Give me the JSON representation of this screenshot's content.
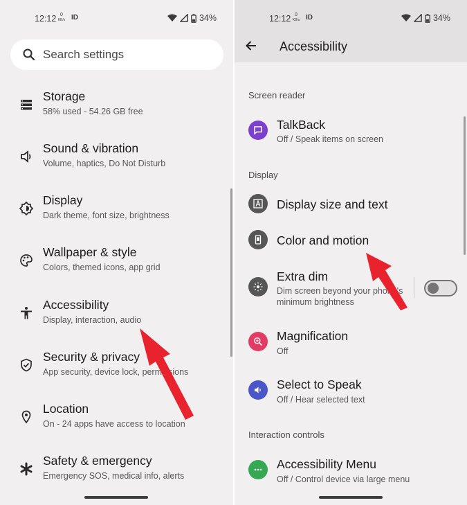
{
  "left": {
    "status": {
      "time": "12:12",
      "net_value": "0",
      "net_unit": "KB/s",
      "battery": "34%"
    },
    "search": {
      "placeholder": "Search settings"
    },
    "items": [
      {
        "title": "Storage",
        "subtitle": "58% used - 54.26 GB free",
        "icon": "storage-icon"
      },
      {
        "title": "Sound & vibration",
        "subtitle": "Volume, haptics, Do Not Disturb",
        "icon": "speaker-icon"
      },
      {
        "title": "Display",
        "subtitle": "Dark theme, font size, brightness",
        "icon": "brightness-icon"
      },
      {
        "title": "Wallpaper & style",
        "subtitle": "Colors, themed icons, app grid",
        "icon": "palette-icon"
      },
      {
        "title": "Accessibility",
        "subtitle": "Display, interaction, audio",
        "icon": "accessibility-icon"
      },
      {
        "title": "Security & privacy",
        "subtitle": "App security, device lock, permissions",
        "icon": "shield-icon"
      },
      {
        "title": "Location",
        "subtitle": "On - 24 apps have access to location",
        "icon": "location-pin-icon"
      },
      {
        "title": "Safety & emergency",
        "subtitle": "Emergency SOS, medical info, alerts",
        "icon": "asterisk-icon"
      }
    ]
  },
  "right": {
    "status": {
      "time": "12:12",
      "net_value": "0",
      "net_unit": "KB/s",
      "battery": "34%"
    },
    "appbar": {
      "title": "Accessibility"
    },
    "sections": {
      "screen_reader": "Screen reader",
      "display": "Display",
      "interaction": "Interaction controls"
    },
    "items": {
      "talkback": {
        "title": "TalkBack",
        "subtitle": "Off / Speak items on screen",
        "color": "#7c3fd0"
      },
      "display_size": {
        "title": "Display size and text",
        "color": "#565656"
      },
      "color_motion": {
        "title": "Color and motion",
        "color": "#565656"
      },
      "extra_dim": {
        "title": "Extra dim",
        "subtitle": "Dim screen beyond your phone's minimum brightness",
        "color": "#565656",
        "toggle_on": false
      },
      "magnification": {
        "title": "Magnification",
        "subtitle": "Off",
        "color": "#e23c64"
      },
      "select_to_speak": {
        "title": "Select to Speak",
        "subtitle": "Off / Hear selected text",
        "color": "#4b57c9"
      },
      "accessibility_menu": {
        "title": "Accessibility Menu",
        "subtitle": "Off / Control device via large menu",
        "color": "#35a853"
      }
    }
  },
  "colors": {
    "annotation_arrow": "#e8232e"
  }
}
